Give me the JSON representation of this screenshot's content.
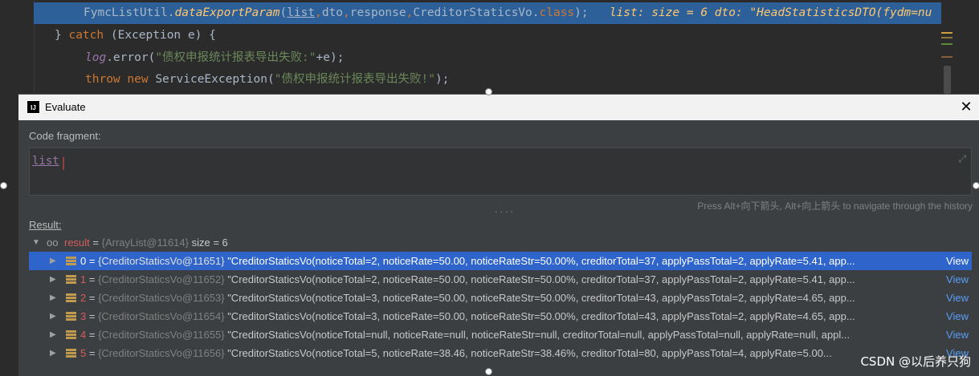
{
  "editor": {
    "line1": {
      "cls": "FymcListUtil.",
      "method": "dataExportParam",
      "open": "(",
      "arg1": "list",
      "c1": ",",
      "arg2": "dto",
      "c2": ",",
      "arg3": "response",
      "c3": ",",
      "arg4": "CreditorStaticsVo.",
      "kwclass": "class",
      "close": ");",
      "hint": "list:  size = 6  dto: \"HeadStatisticsDTO(fydm=nu"
    },
    "line2": {
      "brace": "} ",
      "kw": "catch",
      "rest": " (Exception e) {"
    },
    "line3": {
      "obj": "log",
      "call": ".error(",
      "str": "\"债权申报统计报表导出失败:\"",
      "rest": "+e);"
    },
    "line4": {
      "kw1": "throw",
      "kw2": "new",
      "cls": " ServiceException(",
      "str": "\"债权申报统计报表导出失败!\"",
      "rest": ");"
    }
  },
  "dialog": {
    "icon_text": "IJ",
    "title": "Evaluate",
    "close": "✕",
    "code_label": "Code fragment:",
    "code_value": "list",
    "expand": "⤢",
    "nav_hint": "Press Alt+向下箭头, Alt+向上箭头 to navigate through the history",
    "splitter": "....",
    "result_label": "Result:"
  },
  "result": {
    "root": {
      "name": "result",
      "eq": " = ",
      "addr": "{ArrayList@11614}",
      "size": "  size = 6"
    },
    "items": [
      {
        "index": "0",
        "addr": "{CreditorStaticsVo@11651}",
        "value": "\"CreditorStaticsVo(noticeTotal=2, noticeRate=50.00, noticeRateStr=50.00%, creditorTotal=37, applyPassTotal=2, applyRate=5.41, app...",
        "view": "View"
      },
      {
        "index": "1",
        "addr": "{CreditorStaticsVo@11652}",
        "value": "\"CreditorStaticsVo(noticeTotal=2, noticeRate=50.00, noticeRateStr=50.00%, creditorTotal=37, applyPassTotal=2, applyRate=5.41, app...",
        "view": "View"
      },
      {
        "index": "2",
        "addr": "{CreditorStaticsVo@11653}",
        "value": "\"CreditorStaticsVo(noticeTotal=3, noticeRate=50.00, noticeRateStr=50.00%, creditorTotal=43, applyPassTotal=2, applyRate=4.65, app...",
        "view": "View"
      },
      {
        "index": "3",
        "addr": "{CreditorStaticsVo@11654}",
        "value": "\"CreditorStaticsVo(noticeTotal=3, noticeRate=50.00, noticeRateStr=50.00%, creditorTotal=43, applyPassTotal=2, applyRate=4.65, app...",
        "view": "View"
      },
      {
        "index": "4",
        "addr": "{CreditorStaticsVo@11655}",
        "value": "\"CreditorStaticsVo(noticeTotal=null, noticeRate=null, noticeRateStr=null, creditorTotal=null, applyPassTotal=null, applyRate=null, appl...",
        "view": "View"
      },
      {
        "index": "5",
        "addr": "{CreditorStaticsVo@11656}",
        "value": "\"CreditorStaticsVo(noticeTotal=5, noticeRate=38.46, noticeRateStr=38.46%, creditorTotal=80, applyPassTotal=4, applyRate=5.00...",
        "view": "View"
      }
    ]
  },
  "watermark": "CSDN @以后养只狗",
  "icons": {
    "expanded": "▼",
    "collapsed": "▶",
    "watch": "oo"
  },
  "colors": {
    "selection": "#2f65ca",
    "keyword": "#cc7832",
    "string": "#6a8759",
    "link": "#589df6",
    "variable_name": "#d35d5d"
  }
}
